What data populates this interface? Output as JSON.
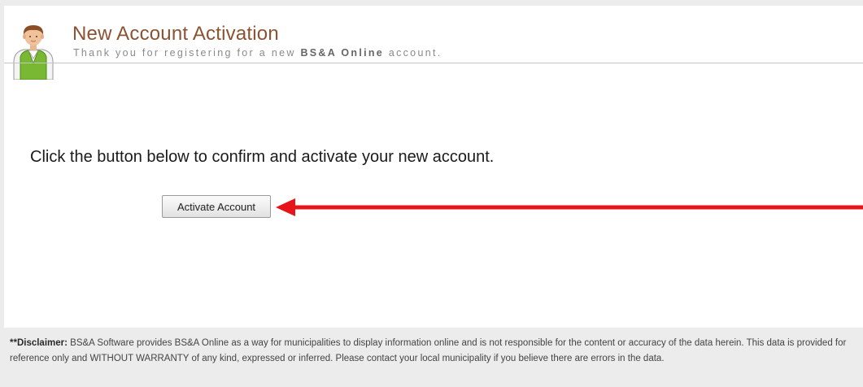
{
  "header": {
    "title": "New Account Activation",
    "subtitle_prefix": "Thank you for registering for a new ",
    "subtitle_brand": "BS&A Online",
    "subtitle_suffix": " account."
  },
  "main": {
    "instruction": "Click the button below to confirm and activate your new account.",
    "activate_label": "Activate Account"
  },
  "annotation": {
    "arrow_color": "#e8141c"
  },
  "footer": {
    "disclaimer_label": "**Disclaimer:",
    "disclaimer_text": " BS&A Software provides BS&A Online as a way for municipalities to display information online and is not responsible for the content or accuracy of the data herein. This data is provided for reference only and WITHOUT WARRANTY of any kind, expressed or inferred. Please contact your local municipality if you believe there are errors in the data."
  },
  "icons": {
    "avatar": "user-avatar-icon"
  }
}
